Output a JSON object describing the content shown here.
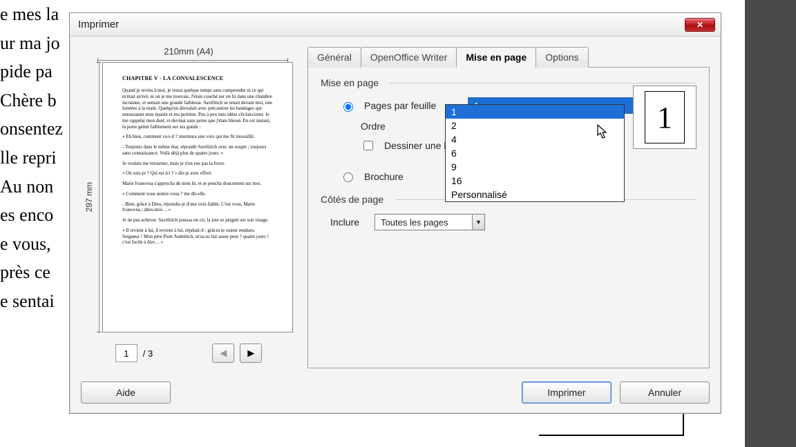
{
  "doc_behind_lines": [
    "e mes la",
    "ur ma jo",
    "pide pa",
    "",
    "Chère b",
    "onsentez",
    "",
    "lle repri",
    "",
    "Au non",
    "es enco",
    "e vous,",
    "",
    "près ce",
    "e sentai"
  ],
  "dialog": {
    "title": "Imprimer",
    "tabs": [
      "Général",
      "OpenOffice Writer",
      "Mise en page",
      "Options"
    ],
    "active_tab": "Mise en page",
    "preview": {
      "top_label": "210mm (A4)",
      "side_label": "297 mm",
      "page_title": "CHAPITRE V - LA CONVALESCENCE",
      "current_page": "1",
      "total_pages": "/ 3"
    },
    "layout": {
      "group_label": "Mise en page",
      "pages_per_sheet_label": "Pages par feuille",
      "pages_per_sheet_value": "1",
      "pages_per_sheet_options": [
        "1",
        "2",
        "4",
        "6",
        "9",
        "16",
        "Personnalisé"
      ],
      "highlighted_option": "1",
      "order_label": "Ordre",
      "draw_border_label": "Dessiner une bordure autour de chaque page",
      "draw_border_visible": "Dessiner une bor",
      "brochure_label": "Brochure",
      "thumb_number": "1"
    },
    "page_sides": {
      "group_label": "Côtés de page",
      "include_label": "Inclure",
      "include_value": "Toutes les pages"
    },
    "buttons": {
      "help": "Aide",
      "print": "Imprimer",
      "cancel": "Annuler"
    }
  }
}
